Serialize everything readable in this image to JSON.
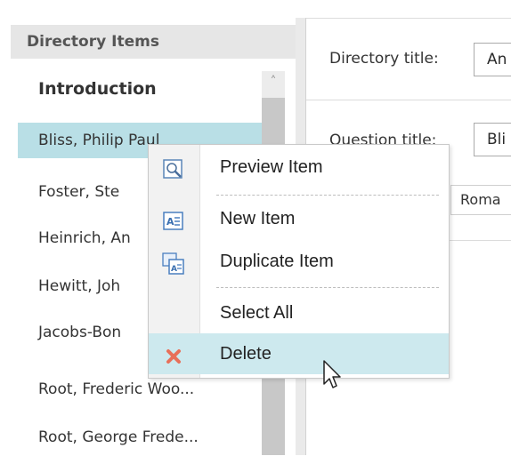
{
  "left_panel": {
    "header": "Directory Items",
    "items": [
      {
        "label": "Introduction"
      },
      {
        "label": "Bliss, Philip Paul"
      },
      {
        "label": "Foster, Ste"
      },
      {
        "label": "Heinrich, An"
      },
      {
        "label": "Hewitt, Joh"
      },
      {
        "label": "Jacobs-Bon"
      },
      {
        "label": "Root, Frederic Woo..."
      },
      {
        "label": "Root, George Frede..."
      }
    ],
    "scroll_up_glyph": "˄"
  },
  "form": {
    "directory_title_label": "Directory title:",
    "directory_title_value": "An",
    "question_title_label": "Question title:",
    "question_title_value": "Bli",
    "font_value": "Roma"
  },
  "context_menu": {
    "items": [
      {
        "label": "Preview Item",
        "icon": "preview-icon"
      },
      {
        "label": "New Item",
        "icon": "new-item-icon"
      },
      {
        "label": "Duplicate Item",
        "icon": "duplicate-icon"
      },
      {
        "label": "Select All",
        "icon": ""
      },
      {
        "label": "Delete",
        "icon": "delete-icon"
      }
    ],
    "hovered": "Delete"
  },
  "colors": {
    "selection": "#b9dfe6",
    "menu_hover": "#cde9ee",
    "delete_icon": "#e8705a"
  }
}
